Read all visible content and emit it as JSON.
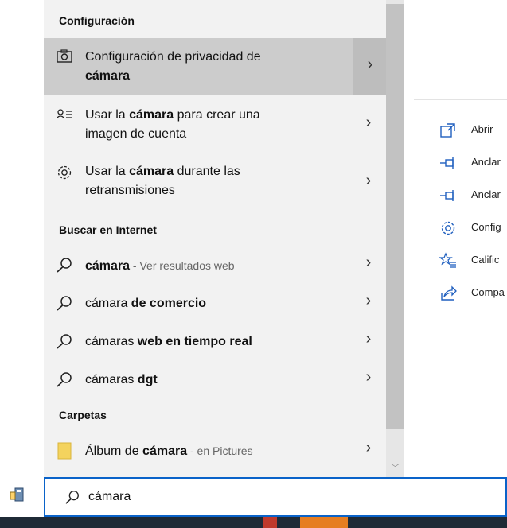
{
  "sections": {
    "settings_header": "Configuración",
    "web_header": "Buscar en Internet",
    "folders_header": "Carpetas"
  },
  "results": {
    "r0": {
      "pre": "Configuración de privacidad de",
      "line2_bold": "cámara"
    },
    "r1": {
      "pre": "Usar la ",
      "bold": "cámara",
      "post": " para crear una",
      "line2": "imagen de cuenta"
    },
    "r2": {
      "pre": "Usar la ",
      "bold": "cámara",
      "post": " durante las",
      "line2": "retransmisiones"
    },
    "w0": {
      "bold": "cámara",
      "sub": " - Ver resultados web"
    },
    "w1": {
      "pre": "cámara ",
      "bold": "de comercio"
    },
    "w2": {
      "pre": "cámaras ",
      "bold": "web en tiempo real"
    },
    "w3": {
      "pre": "cámaras ",
      "bold": "dgt"
    },
    "f0": {
      "pre": "Álbum de ",
      "bold": "cámara",
      "sub": " - en Pictures"
    }
  },
  "actions": [
    {
      "label": "Abrir",
      "icon": "open-icon"
    },
    {
      "label": "Anclar",
      "icon": "pin-icon"
    },
    {
      "label": "Anclar",
      "icon": "pin-icon"
    },
    {
      "label": "Config",
      "icon": "gear-icon"
    },
    {
      "label": "Calific",
      "icon": "rate-icon"
    },
    {
      "label": "Compa",
      "icon": "share-icon"
    }
  ],
  "search": {
    "value": "cámara"
  },
  "colors": {
    "accent": "#0a63c9",
    "selected": "#cccccc",
    "panel": "#f2f2f2",
    "icon_blue": "#1f5fbf",
    "folder": "#f4d35e"
  }
}
